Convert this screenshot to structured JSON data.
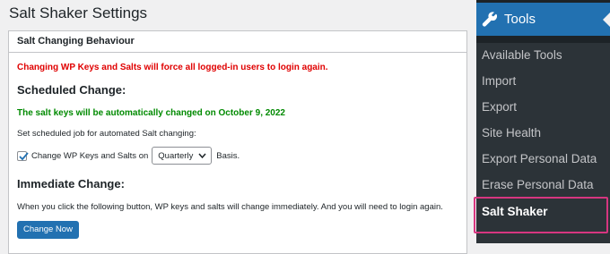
{
  "page": {
    "title": "Salt Shaker Settings"
  },
  "panel": {
    "title": "Salt Changing Behaviour",
    "warning": "Changing WP Keys and Salts will force all logged-in users to login again.",
    "scheduled": {
      "heading": "Scheduled Change:",
      "notice": "The salt keys will be automatically changed on October 9, 2022",
      "description": "Set scheduled job for automated Salt changing:",
      "checkbox_checked": true,
      "checkbox_label": "Change WP Keys and Salts on",
      "frequency_selected": "Quarterly",
      "suffix": "Basis."
    },
    "immediate": {
      "heading": "Immediate Change:",
      "description": "When you click the following button, WP keys and salts will change immediately. And you will need to login again.",
      "button_label": "Change Now"
    }
  },
  "adminmenu": {
    "section": {
      "label": "Tools",
      "icon": "wrench-icon"
    },
    "items": [
      {
        "label": "Available Tools"
      },
      {
        "label": "Import"
      },
      {
        "label": "Export"
      },
      {
        "label": "Site Health"
      },
      {
        "label": "Export Personal Data"
      },
      {
        "label": "Erase Personal Data"
      },
      {
        "label": "Salt Shaker"
      }
    ],
    "colors": {
      "menu_bg": "#1d2327",
      "submenu_bg": "#2c3338",
      "active_section": "#2271b1",
      "highlight_border": "#d63680"
    }
  },
  "colors": {
    "warning": "#e00000",
    "notice": "#008a00",
    "primary_button": "#2271b1"
  }
}
